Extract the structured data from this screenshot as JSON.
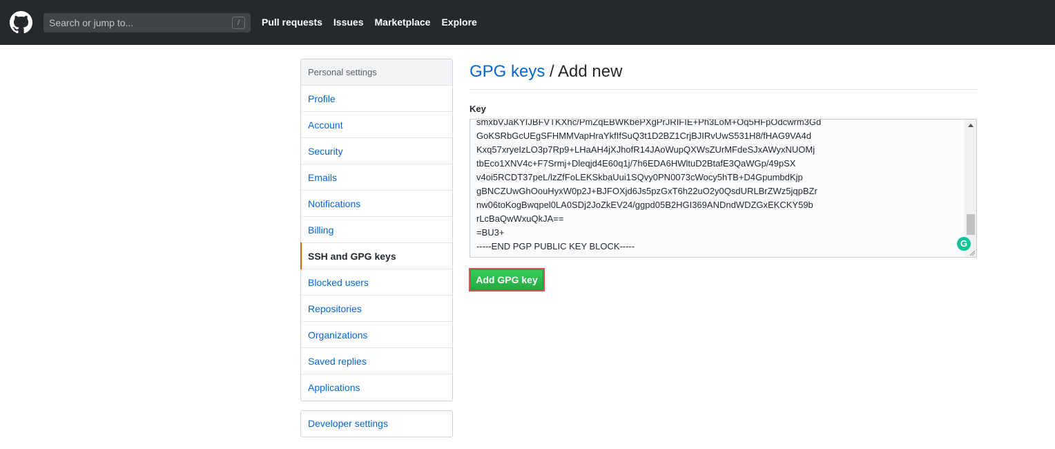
{
  "header": {
    "search_placeholder": "Search or jump to...",
    "slash_hint": "/",
    "nav": [
      "Pull requests",
      "Issues",
      "Marketplace",
      "Explore"
    ]
  },
  "sidebar": {
    "heading": "Personal settings",
    "items": [
      {
        "label": "Profile"
      },
      {
        "label": "Account"
      },
      {
        "label": "Security"
      },
      {
        "label": "Emails"
      },
      {
        "label": "Notifications"
      },
      {
        "label": "Billing"
      },
      {
        "label": "SSH and GPG keys",
        "selected": true
      },
      {
        "label": "Blocked users"
      },
      {
        "label": "Repositories"
      },
      {
        "label": "Organizations"
      },
      {
        "label": "Saved replies"
      },
      {
        "label": "Applications"
      }
    ],
    "developer_settings": "Developer settings"
  },
  "main": {
    "breadcrumb": "GPG keys",
    "separator": " / ",
    "title": "Add new",
    "key_label": "Key",
    "key_value": "smxbVJaKYIJBFVTKXhc/PmZqEBWKbePXgPrJRIFIE+Ph3LoM+Oq5HFpOdcwrm3Gd\nGoKSRbGcUEgSFHMMVapHraYkfIfSuQ3t1D2BZ1CrjBJIRvUwS531H8/fHAG9VA4d\nKxq57xryeIzLO3p7Rp9+LHaAH4jXJhofR14JAoWupQXWsZUrMFdeSJxAWyxNUOMj\ntbEco1XNV4c+F7Srmj+Dleqjd4E60q1j/7h6EDA6HWltuD2BtafE3QaWGp/49pSX\nv4oi5RCDT37peL/lzZfFoLEKSkbaUui1SQvy0PN0073cWocy5hTB+D4GpumbdKjp\ngBNCZUwGhOouHyxW0p2J+BJFOXjd6Js5pzGxT6h22uO2y0QsdURLBrZWz5jqpBZr\nnw06toKogBwqpel0LA0SDj2JoZkEV24/ggpd05B2HGI369ANDndWDZGxEKCKY59b\nrLcBaQwWxuQkJA==\n=BU3+\n-----END PGP PUBLIC KEY BLOCK-----",
    "add_button": "Add GPG key"
  },
  "colors": {
    "header_bg": "#24292e",
    "link": "#0366d6",
    "selected_accent": "#e36209",
    "button_green": "#28a745",
    "highlight_border": "#d9534f"
  }
}
